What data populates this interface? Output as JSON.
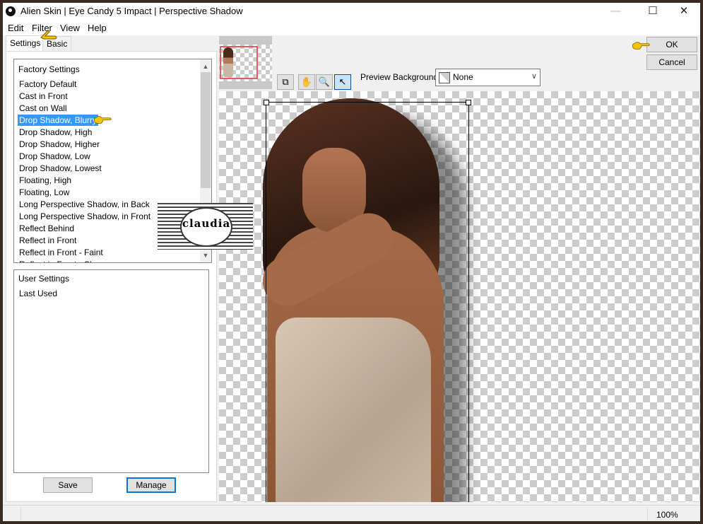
{
  "window": {
    "title": "Alien Skin | Eye Candy 5 Impact | Perspective Shadow",
    "controls": {
      "minimize": "—",
      "maximize": "☐",
      "close": "✕"
    }
  },
  "menu": [
    "Edit",
    "Filter",
    "View",
    "Help"
  ],
  "tabs": [
    {
      "label": "Settings",
      "active": true
    },
    {
      "label": "Basic",
      "active": false
    }
  ],
  "factory_settings": {
    "header": "Factory Settings",
    "selected": "Drop Shadow, Blurry",
    "items": [
      "Factory Default",
      "Cast in Front",
      "Cast on Wall",
      "Drop Shadow, Blurry",
      "Drop Shadow, High",
      "Drop Shadow, Higher",
      "Drop Shadow, Low",
      "Drop Shadow, Lowest",
      "Floating, High",
      "Floating, Low",
      "Long Perspective Shadow, in Back",
      "Long Perspective Shadow, in Front",
      "Reflect Behind",
      "Reflect in Front",
      "Reflect in Front - Faint",
      "Reflect in Front - Sharp"
    ]
  },
  "user_settings": {
    "header": "User Settings",
    "items": [
      "Last Used"
    ]
  },
  "buttons": {
    "save": "Save",
    "manage": "Manage",
    "ok": "OK",
    "cancel": "Cancel"
  },
  "toolbar": {
    "tools": [
      {
        "name": "navigator-tool",
        "glyph": "⧉"
      },
      {
        "name": "hand-tool",
        "glyph": "✋"
      },
      {
        "name": "zoom-tool",
        "glyph": "🔍"
      },
      {
        "name": "select-tool",
        "glyph": "↖",
        "active": true
      }
    ],
    "preview_background_label": "Preview Background:",
    "preview_background_value": "None"
  },
  "watermark": {
    "text": "claudia"
  },
  "status": {
    "zoom": "100%"
  },
  "colors": {
    "selection": "#3399ff",
    "default_button_border": "#0078d7",
    "thumbnail_frame": "#e85c5c",
    "pointer_hand": "#f5c400"
  }
}
